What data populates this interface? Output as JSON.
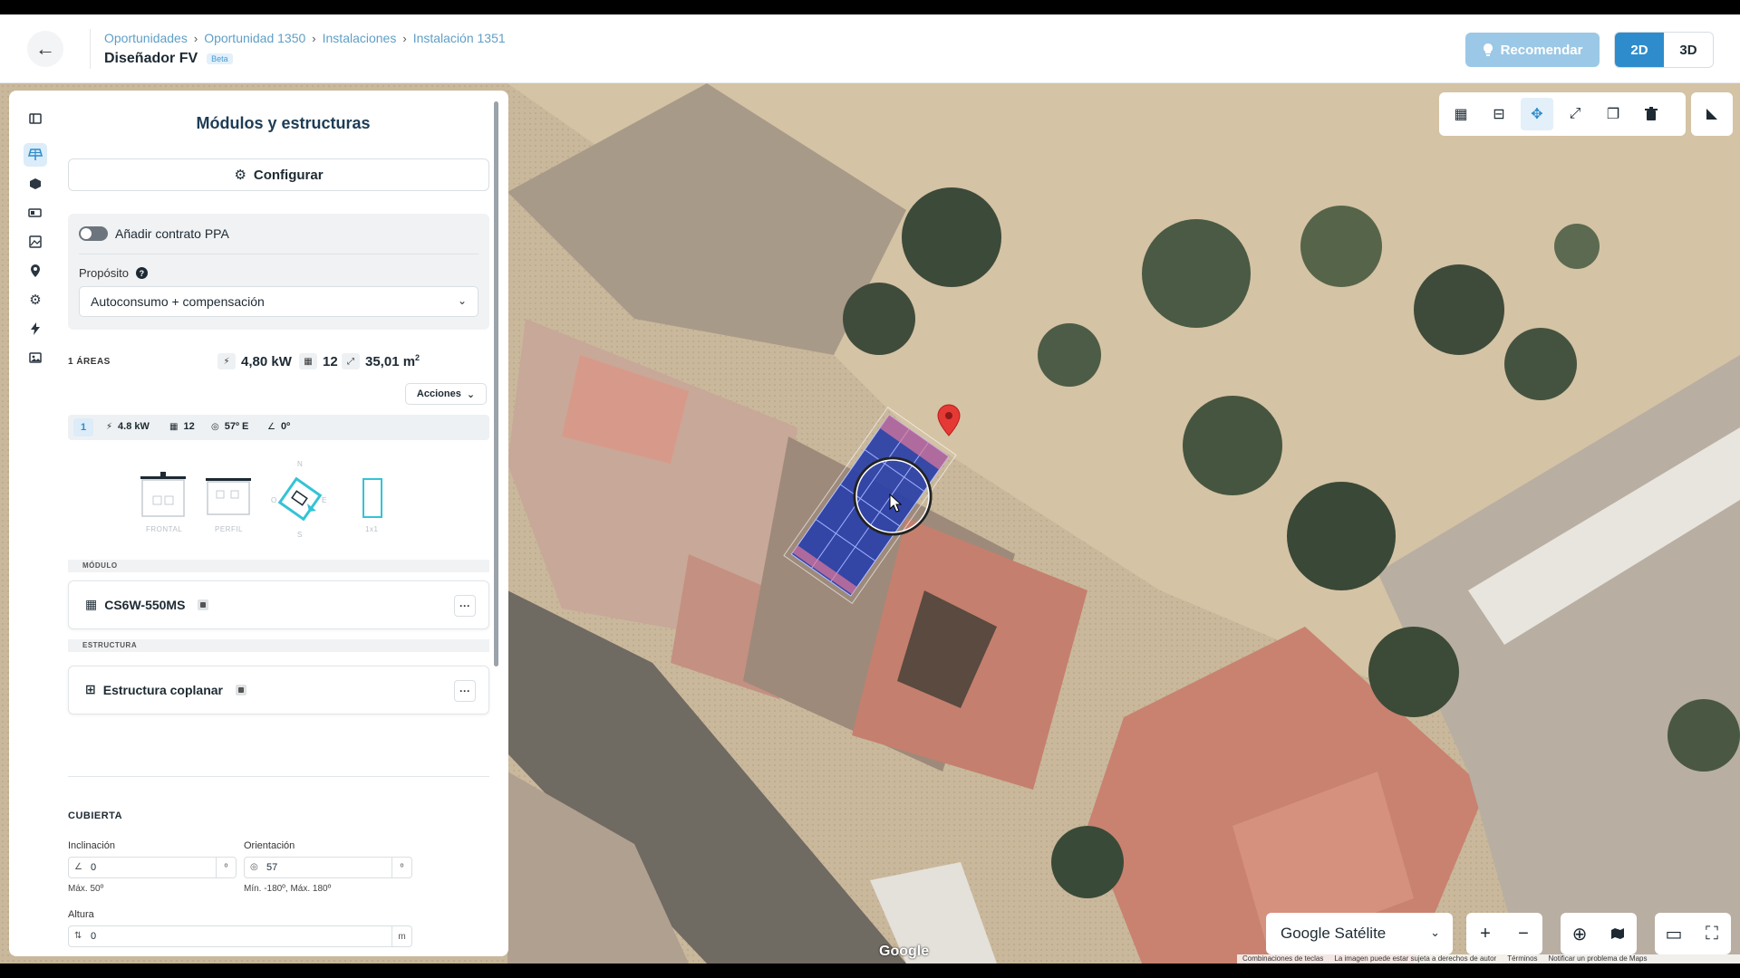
{
  "header": {
    "breadcrumb": [
      "Oportunidades",
      "Oportunidad 1350",
      "Instalaciones",
      "Instalación 1351"
    ],
    "title": "Diseñador FV",
    "beta": "Beta",
    "recommend_label": "Recomendar",
    "view_2d": "2D",
    "view_3d": "3D",
    "active_view": "2D"
  },
  "sidebar": {
    "rail_icons": [
      "sidebar-toggle-icon",
      "solar-panel-icon",
      "cube-icon",
      "battery-icon",
      "image-icon",
      "location-pin-icon",
      "gear-icon",
      "lightning-icon",
      "photo-icon"
    ],
    "active_icon": "solar-panel-icon"
  },
  "panel": {
    "title": "Módulos y estructuras",
    "configure_label": "Configurar",
    "ppa_label": "Añadir contrato PPA",
    "ppa_enabled": false,
    "purpose_label": "Propósito",
    "purpose_value": "Autoconsumo + compensación",
    "areas_label": "1 ÁREAS",
    "total_power": "4,80 kW",
    "total_modules": "12",
    "total_area": "35,01 m",
    "area_unit_sup": "2",
    "actions_label": "Acciones",
    "area_chip": {
      "index": "1",
      "power": "4.8 kW",
      "modules": "12",
      "orientation": "57º E",
      "tilt": "0º"
    },
    "diagram_labels": {
      "frontal": "FRONTAL",
      "perfil": "PERFIL",
      "north": "N",
      "south": "S",
      "east": "E",
      "west": "O",
      "layout": "1x1"
    },
    "module_section": "MÓDULO",
    "module_name": "CS6W-550MS",
    "structure_section": "ESTRUCTURA",
    "structure_name": "Estructura coplanar",
    "more": "···",
    "roof_section": "CUBIERTA",
    "tilt_label": "Inclinación",
    "tilt_value": "0",
    "tilt_unit": "º",
    "tilt_hint": "Máx. 50º",
    "orientation_label": "Orientación",
    "orientation_value": "57",
    "orientation_unit": "º",
    "orientation_hint": "Mín. -180º, Máx. 180º",
    "height_label": "Altura",
    "height_value": "0",
    "height_unit": "m"
  },
  "map": {
    "layer": "Google Satélite",
    "zoom_in": "+",
    "zoom_out": "−",
    "google_logo": "Google",
    "attribution": [
      "Combinaciones de teclas",
      "La imagen puede estar sujeta a derechos de autor",
      "Términos",
      "Notificar un problema de Maps"
    ]
  },
  "toolbar": {
    "icons": [
      "grid-select-icon",
      "grid-edit-icon",
      "move-icon",
      "resize-icon",
      "duplicate-icon",
      "trash-icon"
    ],
    "active": "move-icon",
    "extra": "measure-icon"
  },
  "colors": {
    "accent": "#2e8ccc",
    "panel_blue": "#2a3fa8",
    "pin_red": "#e53935"
  }
}
